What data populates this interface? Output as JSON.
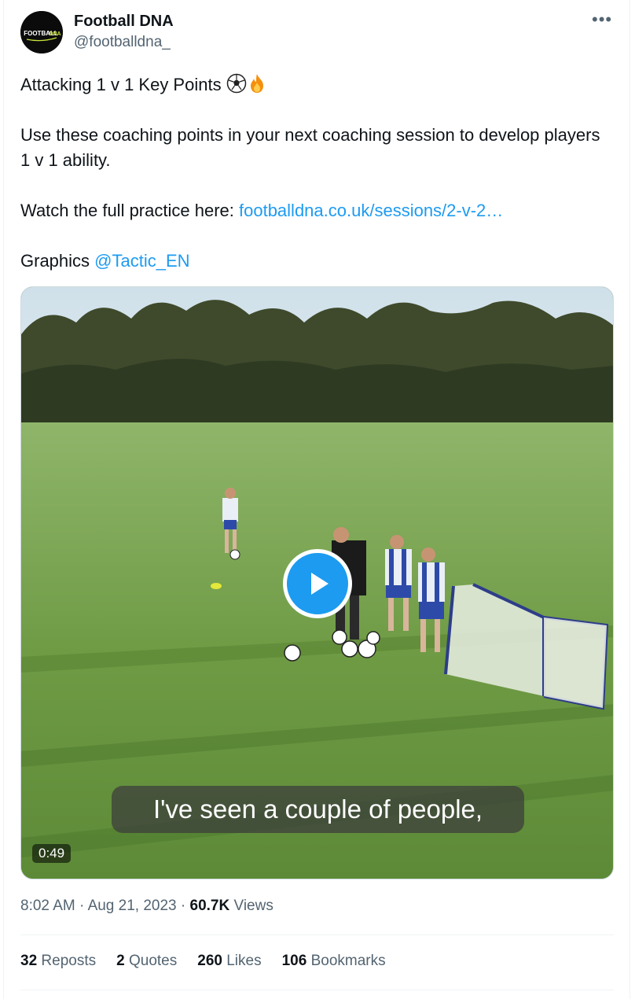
{
  "author": {
    "name": "Football DNA",
    "handle": "@footballdna_",
    "avatar_text": "FOOTBALL DNA"
  },
  "tweet": {
    "line1": "Attacking 1 v 1 Key Points",
    "line1_emojis": [
      "soccer-ball-icon",
      "fire-icon"
    ],
    "paragraph2": "Use these coaching points in your next coaching session to develop players 1 v 1 ability.",
    "line3_prefix": "Watch the full practice here:",
    "line3_link": "footballdna.co.uk/sessions/2-v-2…",
    "line4_prefix": "Graphics",
    "line4_mention": "@Tactic_EN"
  },
  "video": {
    "caption": "I've seen a couple of people,",
    "duration": "0:49"
  },
  "meta": {
    "time": "8:02 AM",
    "date": "Aug 21, 2023",
    "views_count": "60.7K",
    "views_label": "Views"
  },
  "stats": {
    "reposts_count": "32",
    "reposts_label": "Reposts",
    "quotes_count": "2",
    "quotes_label": "Quotes",
    "likes_count": "260",
    "likes_label": "Likes",
    "bookmarks_count": "106",
    "bookmarks_label": "Bookmarks"
  },
  "colors": {
    "link": "#1d9bf0",
    "secondary_text": "#536471",
    "primary_text": "#0f1419"
  }
}
